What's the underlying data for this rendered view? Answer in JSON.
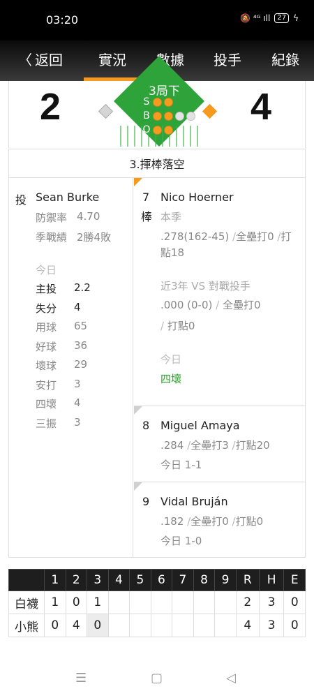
{
  "status_bar": {
    "time": "03:20",
    "icons": "🔕 ⁴ᴳ ıll",
    "battery": "27"
  },
  "nav": {
    "back_label": "返回",
    "tabs": [
      "實況",
      "數據",
      "投手",
      "紀錄"
    ],
    "active_tab": 0
  },
  "scoreboard": {
    "away_score": "2",
    "home_score": "4",
    "inning": "3局下",
    "count": {
      "s_label": "S",
      "strikes": 2,
      "b_label": "B",
      "balls": 2,
      "o_label": "O",
      "outs": 2
    }
  },
  "play_result": "3.揮棒落空",
  "pitcher": {
    "role": "投",
    "name": "Sean Burke",
    "era_label": "防禦率",
    "era": "4.70",
    "record_label": "季戰績",
    "record": "2勝4敗",
    "today_label": "今日",
    "stats": [
      {
        "label": "主投",
        "value": "2.2"
      },
      {
        "label": "失分",
        "value": "4"
      },
      {
        "label": "用球",
        "value": "65"
      },
      {
        "label": "好球",
        "value": "36"
      },
      {
        "label": "壞球",
        "value": "29"
      },
      {
        "label": "安打",
        "value": "3"
      },
      {
        "label": "四壞",
        "value": "4"
      },
      {
        "label": "三振",
        "value": "3"
      }
    ]
  },
  "batters": [
    {
      "order": "7",
      "order_suffix": "棒",
      "name": "Nico Hoerner",
      "season_label": "本季",
      "season_line1_a": ".278(162-45)",
      "season_sep1": " /",
      "season_line1_b": "全壘打0",
      "season_sep2": " /",
      "season_line1_c": "打",
      "season_line2": "點18",
      "vs_label": "近3年 VS 對戰投手",
      "vs_line1_a": ".000 (0-0)",
      "vs_sep1": " / ",
      "vs_line1_b": "全壘打0",
      "vs_sep2": "/",
      "vs_line2": " 打點0",
      "today_label": "今日",
      "today_result": "四壞"
    },
    {
      "order": "8",
      "name": "Miguel Amaya",
      "line_a": ".284",
      "line_sep1": " /",
      "line_b": "全壘打3",
      "line_sep2": " /",
      "line_c": "打點20",
      "today": "今日 1-1"
    },
    {
      "order": "9",
      "name": "Vidal Bruján",
      "line_a": ".182",
      "line_sep1": " /",
      "line_b": "全壘打0",
      "line_sep2": " /",
      "line_c": "打點0",
      "today": "今日 1-0"
    }
  ],
  "linescore": {
    "headers": [
      "",
      "1",
      "2",
      "3",
      "4",
      "5",
      "6",
      "7",
      "8",
      "9",
      "R",
      "H",
      "E"
    ],
    "rows": [
      {
        "team": "白襪",
        "innings": [
          "1",
          "0",
          "1",
          "",
          "",
          "",
          "",
          "",
          ""
        ],
        "r": "2",
        "h": "3",
        "e": "0"
      },
      {
        "team": "小熊",
        "innings": [
          "0",
          "4",
          "0",
          "",
          "",
          "",
          "",
          "",
          ""
        ],
        "r": "4",
        "h": "3",
        "e": "0"
      }
    ]
  },
  "system_nav": {
    "menu": "☰",
    "home": "▢",
    "back": "◁"
  },
  "colors": {
    "accent": "#f59a1e",
    "field_green": "#2ea33a",
    "today_green": "#29a329"
  }
}
